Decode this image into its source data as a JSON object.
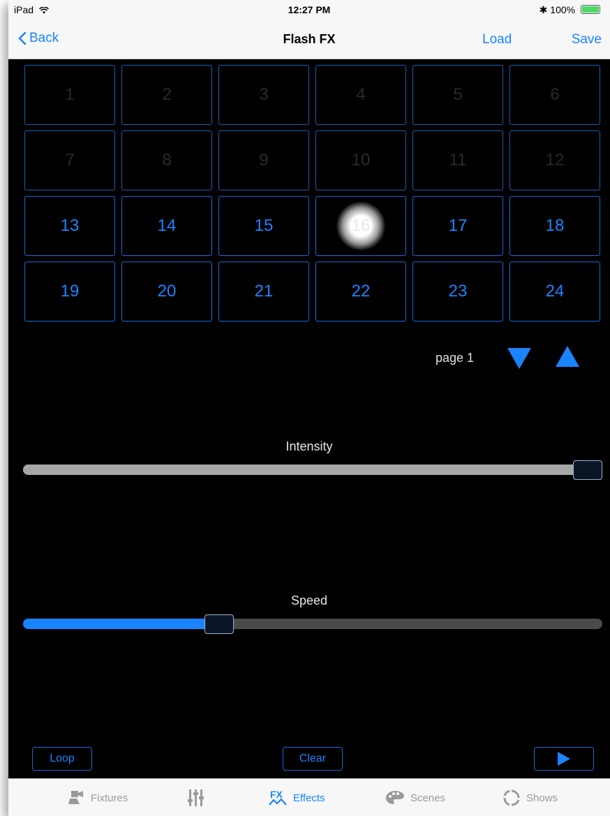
{
  "status": {
    "device": "iPad",
    "time": "12:27 PM",
    "battery": "100%"
  },
  "nav": {
    "back_label": "Back",
    "title": "Flash FX",
    "load_label": "Load",
    "save_label": "Save"
  },
  "grid": {
    "cells": [
      "1",
      "2",
      "3",
      "4",
      "5",
      "6",
      "7",
      "8",
      "9",
      "10",
      "11",
      "12",
      "13",
      "14",
      "15",
      "16",
      "17",
      "18",
      "19",
      "20",
      "21",
      "22",
      "23",
      "24"
    ],
    "active_from": 13,
    "lit_cell": 16
  },
  "pager": {
    "label": "page 1"
  },
  "intensity": {
    "label": "Intensity",
    "value": 1.0
  },
  "speed": {
    "label": "Speed",
    "value": 0.33
  },
  "buttons": {
    "loop": "Loop",
    "clear": "Clear",
    "play_icon": "play-icon"
  },
  "tabs": [
    {
      "label": "Fixtures",
      "icon": "fixture-icon",
      "selected": false
    },
    {
      "label": "",
      "icon": "mixer-icon",
      "selected": false
    },
    {
      "label": "Effects",
      "icon": "fx-icon",
      "selected": true
    },
    {
      "label": "Scenes",
      "icon": "palette-icon",
      "selected": false
    },
    {
      "label": "Shows",
      "icon": "circle-arrows-icon",
      "selected": false
    }
  ],
  "colors": {
    "accent": "#1a84ff",
    "background": "#000000",
    "inactive_text": "#2a2a2a"
  }
}
